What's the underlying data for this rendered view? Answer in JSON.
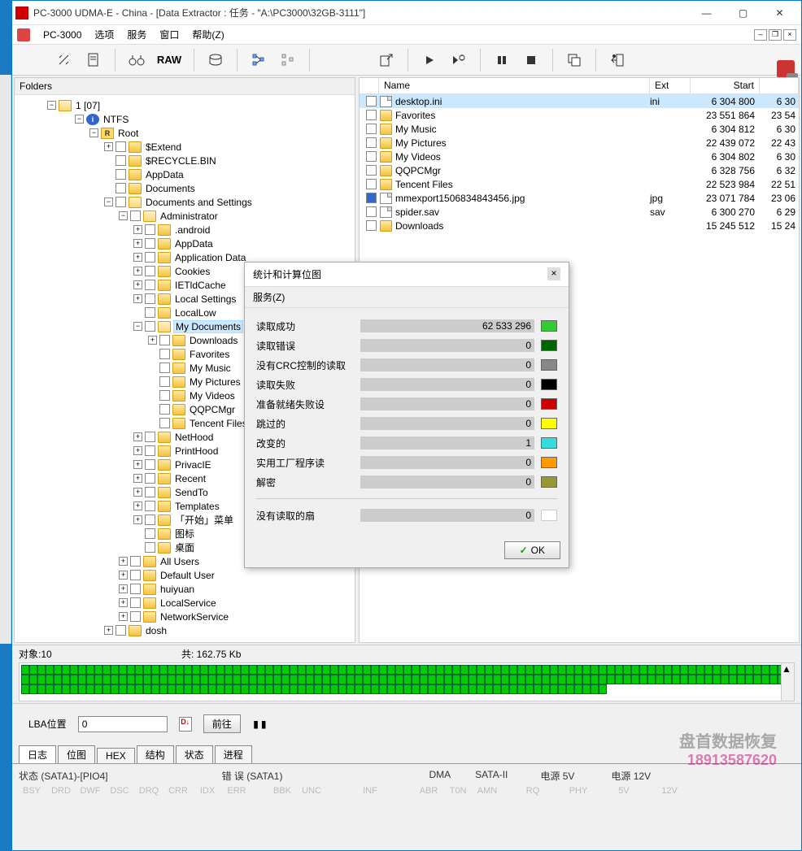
{
  "titlebar": {
    "title": "PC-3000 UDMA-E - China - [Data Extractor : 任务 - \"A:\\PC3000\\32GB-3111\"]"
  },
  "menubar": {
    "app": "PC-3000",
    "items": [
      "选项",
      "服务",
      "窗口",
      "帮助(Z)"
    ]
  },
  "toolbar": {
    "raw": "RAW"
  },
  "leftpanel": {
    "header": "Folders",
    "root_num": "1 [07]",
    "tree": [
      {
        "d": 3,
        "exp": "-",
        "ico": "ntfs",
        "label": "NTFS",
        "icoTxt": "i"
      },
      {
        "d": 4,
        "exp": "-",
        "ico": "root",
        "label": "Root",
        "icoTxt": "R"
      },
      {
        "d": 5,
        "exp": "+",
        "cb": true,
        "ico": "fldr",
        "label": "$Extend"
      },
      {
        "d": 5,
        "exp": "",
        "cb": true,
        "ico": "fldr",
        "label": "$RECYCLE.BIN"
      },
      {
        "d": 5,
        "exp": "",
        "cb": true,
        "ico": "fldr",
        "label": "AppData"
      },
      {
        "d": 5,
        "exp": "",
        "cb": true,
        "ico": "fldr",
        "label": "Documents"
      },
      {
        "d": 5,
        "exp": "-",
        "cb": true,
        "ico": "fldr-o",
        "label": "Documents and Settings"
      },
      {
        "d": 6,
        "exp": "-",
        "cb": true,
        "ico": "fldr-o",
        "label": "Administrator"
      },
      {
        "d": 7,
        "exp": "+",
        "cb": true,
        "ico": "fldr",
        "label": ".android"
      },
      {
        "d": 7,
        "exp": "+",
        "cb": true,
        "ico": "fldr",
        "label": "AppData"
      },
      {
        "d": 7,
        "exp": "+",
        "cb": true,
        "ico": "fldr",
        "label": "Application Data"
      },
      {
        "d": 7,
        "exp": "+",
        "cb": true,
        "ico": "fldr",
        "label": "Cookies"
      },
      {
        "d": 7,
        "exp": "+",
        "cb": true,
        "ico": "fldr",
        "label": "IETldCache"
      },
      {
        "d": 7,
        "exp": "+",
        "cb": true,
        "ico": "fldr",
        "label": "Local Settings"
      },
      {
        "d": 7,
        "exp": "",
        "cb": true,
        "ico": "fldr",
        "label": "LocalLow"
      },
      {
        "d": 7,
        "exp": "-",
        "cb": true,
        "ico": "fldr-o",
        "label": "My Documents",
        "sel": true
      },
      {
        "d": 8,
        "exp": "+",
        "cb": true,
        "ico": "fldr",
        "label": "Downloads"
      },
      {
        "d": 8,
        "exp": "",
        "cb": true,
        "ico": "fldr",
        "label": "Favorites"
      },
      {
        "d": 8,
        "exp": "",
        "cb": true,
        "ico": "fldr",
        "label": "My Music"
      },
      {
        "d": 8,
        "exp": "",
        "cb": true,
        "ico": "fldr",
        "label": "My Pictures"
      },
      {
        "d": 8,
        "exp": "",
        "cb": true,
        "ico": "fldr",
        "label": "My Videos"
      },
      {
        "d": 8,
        "exp": "",
        "cb": true,
        "ico": "fldr",
        "label": "QQPCMgr"
      },
      {
        "d": 8,
        "exp": "",
        "cb": true,
        "ico": "fldr",
        "label": "Tencent Files"
      },
      {
        "d": 7,
        "exp": "+",
        "cb": true,
        "ico": "fldr",
        "label": "NetHood"
      },
      {
        "d": 7,
        "exp": "+",
        "cb": true,
        "ico": "fldr",
        "label": "PrintHood"
      },
      {
        "d": 7,
        "exp": "+",
        "cb": true,
        "ico": "fldr",
        "label": "PrivacIE"
      },
      {
        "d": 7,
        "exp": "+",
        "cb": true,
        "ico": "fldr",
        "label": "Recent"
      },
      {
        "d": 7,
        "exp": "+",
        "cb": true,
        "ico": "fldr",
        "label": "SendTo"
      },
      {
        "d": 7,
        "exp": "+",
        "cb": true,
        "ico": "fldr",
        "label": "Templates"
      },
      {
        "d": 7,
        "exp": "+",
        "cb": true,
        "ico": "fldr",
        "label": "「开始」菜单"
      },
      {
        "d": 7,
        "exp": "",
        "cb": true,
        "ico": "fldr",
        "label": "图标"
      },
      {
        "d": 7,
        "exp": "",
        "cb": true,
        "ico": "fldr",
        "label": "桌面"
      },
      {
        "d": 6,
        "exp": "+",
        "cb": true,
        "ico": "fldr",
        "label": "All Users"
      },
      {
        "d": 6,
        "exp": "+",
        "cb": true,
        "ico": "fldr",
        "label": "Default User"
      },
      {
        "d": 6,
        "exp": "+",
        "cb": true,
        "ico": "fldr",
        "label": "huiyuan"
      },
      {
        "d": 6,
        "exp": "+",
        "cb": true,
        "ico": "fldr",
        "label": "LocalService"
      },
      {
        "d": 6,
        "exp": "+",
        "cb": true,
        "ico": "fldr",
        "label": "NetworkService"
      },
      {
        "d": 5,
        "exp": "+",
        "cb": true,
        "ico": "fldr",
        "label": "dosh"
      }
    ]
  },
  "rightpanel": {
    "columns": [
      "Name",
      "Ext",
      "Start",
      ""
    ],
    "rows": [
      {
        "name": "desktop.ini",
        "ext": "ini",
        "start": "6 304 800",
        "end": "6 30",
        "ico": "file",
        "sel": true
      },
      {
        "name": "Favorites",
        "ext": "",
        "start": "23 551 864",
        "end": "23 54",
        "ico": "fldr"
      },
      {
        "name": "My Music",
        "ext": "",
        "start": "6 304 812",
        "end": "6 30",
        "ico": "fldr"
      },
      {
        "name": "My Pictures",
        "ext": "",
        "start": "22 439 072",
        "end": "22 43",
        "ico": "fldr"
      },
      {
        "name": "My Videos",
        "ext": "",
        "start": "6 304 802",
        "end": "6 30",
        "ico": "fldr"
      },
      {
        "name": "QQPCMgr",
        "ext": "",
        "start": "6 328 756",
        "end": "6 32",
        "ico": "fldr"
      },
      {
        "name": "Tencent Files",
        "ext": "",
        "start": "22 523 984",
        "end": "22 51",
        "ico": "fldr"
      },
      {
        "name": "mmexport1506834843456.jpg",
        "ext": "jpg",
        "start": "23 071 784",
        "end": "23 06",
        "ico": "file",
        "cbchk": true
      },
      {
        "name": "spider.sav",
        "ext": "sav",
        "start": "6 300 270",
        "end": "6 29",
        "ico": "file"
      },
      {
        "name": "Downloads",
        "ext": "",
        "start": "15 245 512",
        "end": "15 24",
        "ico": "fldr"
      }
    ]
  },
  "modal": {
    "title": "统计和计算位图",
    "menu": "服务(Z)",
    "stats": [
      {
        "label": "读取成功",
        "value": "62 533 296",
        "color": "#33cc33"
      },
      {
        "label": "读取错误",
        "value": "0",
        "color": "#006600"
      },
      {
        "label": "没有CRC控制的读取",
        "value": "0",
        "color": "#888888"
      },
      {
        "label": "读取失败",
        "value": "0",
        "color": "#000000"
      },
      {
        "label": "准备就绪失败设",
        "value": "0",
        "color": "#cc0000"
      },
      {
        "label": "跳过的",
        "value": "0",
        "color": "#ffff00"
      },
      {
        "label": "改变的",
        "value": "1",
        "color": "#33dddd"
      },
      {
        "label": "实用工厂程序读",
        "value": "0",
        "color": "#ff9900"
      },
      {
        "label": "解密",
        "value": "0",
        "color": "#999933"
      }
    ],
    "unread": {
      "label": "没有读取的扇",
      "value": "0",
      "color": "#ffffff"
    },
    "ok": "OK"
  },
  "status": {
    "objects_lbl": "对象:",
    "objects": "10",
    "total_lbl": "共:",
    "total": "  162.75 Kb"
  },
  "lba": {
    "label": "LBA位置",
    "value": "0",
    "goto": "前往"
  },
  "tabs": [
    "日志",
    "位图",
    "HEX",
    "结构",
    "状态",
    "进程"
  ],
  "bottom": {
    "headers": [
      "状态 (SATA1)-[PIO4]",
      "错 误 (SATA1)",
      "DMA",
      "SATA-II",
      "电源 5V",
      "电源 12V"
    ],
    "ind1": [
      "BSY",
      "DRD",
      "DWF",
      "DSC",
      "DRQ",
      "CRR",
      "IDX",
      "ERR"
    ],
    "ind2": [
      "BBK",
      "UNC",
      "",
      "INF",
      "",
      "ABR",
      "T0N",
      "AMN"
    ],
    "ind3": [
      "RQ"
    ],
    "ind4": [
      "PHY"
    ],
    "ind5": [
      "5V"
    ],
    "ind6": [
      "12V"
    ]
  },
  "watermark": {
    "line1": "盘首数据恢复",
    "line2": "18913587620"
  }
}
